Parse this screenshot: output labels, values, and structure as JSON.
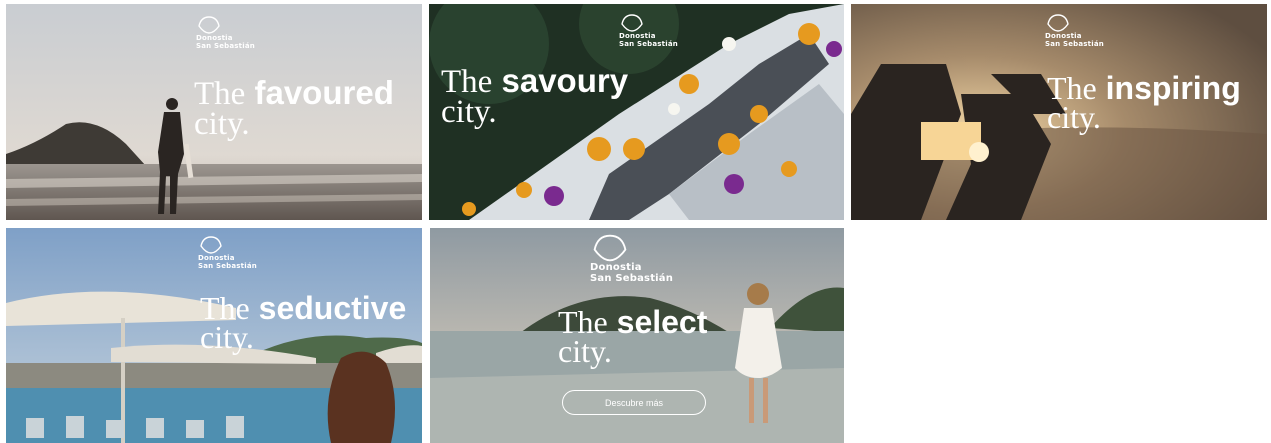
{
  "brand": {
    "line1": "Donostia",
    "line2": "San Sebastián"
  },
  "tiles": [
    {
      "w1": "The",
      "w2": "favoured",
      "w3": "city."
    },
    {
      "w1": "The",
      "w2": "savoury",
      "w3": "city."
    },
    {
      "w1": "The",
      "w2": "inspiring",
      "w3": "city."
    },
    {
      "w1": "The",
      "w2": "seductive",
      "w3": "city."
    },
    {
      "w1": "The",
      "w2": "select",
      "w3": "city.",
      "cta": "Descubre más"
    }
  ]
}
